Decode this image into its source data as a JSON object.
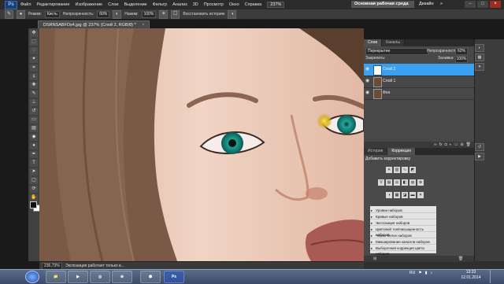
{
  "menu": {
    "logo": "Ps",
    "items": [
      "Файл",
      "Редактирование",
      "Изображение",
      "Слои",
      "Выделение",
      "Фильтр",
      "Анализ",
      "3D",
      "Просмотр",
      "Окно",
      "Справка"
    ],
    "zoom": "237%",
    "workspace_active": "Основная рабочая среда",
    "workspace_other": "Дизайн",
    "workspace_more": "»"
  },
  "options_bar": {
    "mode_label": "Режим:",
    "mode_value": "Кисть",
    "opacity_label": "Непрозрачность:",
    "opacity_value": "60%",
    "flow_label": "Нажим:",
    "flow_value": "100%",
    "history_label": "Восстановить историю"
  },
  "document": {
    "tab_title": "DSRNSABFDx4.jpg @ 237% (Слой 2, RGB/8) *",
    "zoom": "236,73%",
    "status_text": "Экспозиция работает только в..."
  },
  "layers_panel": {
    "tabs": [
      "Слои",
      "Каналы"
    ],
    "blend_mode": "Перекрытие",
    "opacity_label": "Непрозрачность:",
    "opacity_value": "62%",
    "lock_label": "Закрепить:",
    "fill_label": "Заливка:",
    "fill_value": "100%",
    "layers": [
      {
        "name": "Слой 2",
        "selected": true
      },
      {
        "name": "Слой 1",
        "selected": false
      },
      {
        "name": "Фон",
        "selected": false
      }
    ]
  },
  "adjustments_panel": {
    "tabs": [
      "История",
      "Коррекция"
    ],
    "title": "Добавить корректировку",
    "presets": [
      "Уровни наборов",
      "Кривые наборов",
      "Экспозиция наборов",
      "Цветовой тон/Насыщенность наборов",
      "Черно-белое наборов",
      "Микширование каналов наборов",
      "Выборочная коррекция цвета наборов"
    ]
  },
  "taskbar": {
    "tray_lang": "RU",
    "time": "13:33",
    "date": "12.01.2014"
  }
}
